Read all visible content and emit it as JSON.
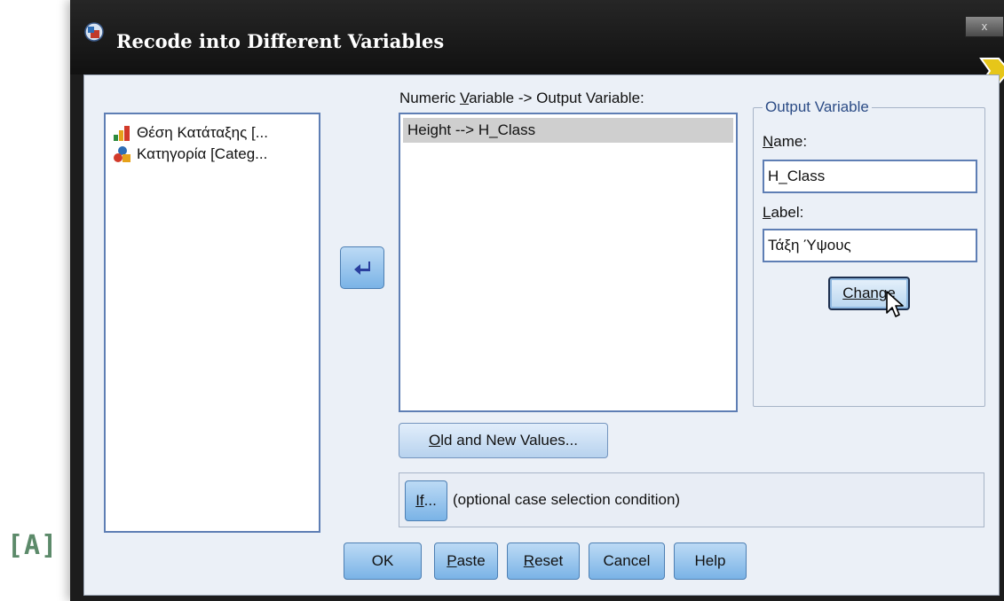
{
  "corner_tag": "[A]",
  "window": {
    "title": "Recode into Different Variables",
    "close_label": "x"
  },
  "source_variables": {
    "items": [
      {
        "label": "Θέση Κατάταξης [...",
        "icon": "ordinal-bar-icon"
      },
      {
        "label": "Κατηγορία [Categ...",
        "icon": "nominal-shapes-icon"
      }
    ]
  },
  "numeric_variable": {
    "label_pre": "Numeric ",
    "label_u": "V",
    "label_post": "ariable -> Output Variable:",
    "rows": [
      "Height --> H_Class"
    ]
  },
  "output_variable": {
    "legend": "Output Variable",
    "name_label_u": "N",
    "name_label_rest": "ame:",
    "name_value": "H_Class",
    "label_label_u": "L",
    "label_label_rest": "abel:",
    "label_value": "Τάξη Ύψους",
    "change_u": "Change"
  },
  "old_new_button": {
    "u": "O",
    "rest": "ld and New Values..."
  },
  "if_panel": {
    "button_u": "If",
    "button_rest": "...",
    "text": "(optional case selection condition)"
  },
  "buttons": {
    "ok": "OK",
    "paste_u": "P",
    "paste_rest": "aste",
    "reset_u": "R",
    "reset_rest": "eset",
    "cancel": "Cancel",
    "help": "Help"
  },
  "colors": {
    "title_bar": "#1c1c1c",
    "dialog_bg": "#ebf0f7",
    "button_blue": "#7ab3e6",
    "selection": "#cfcfcf"
  }
}
